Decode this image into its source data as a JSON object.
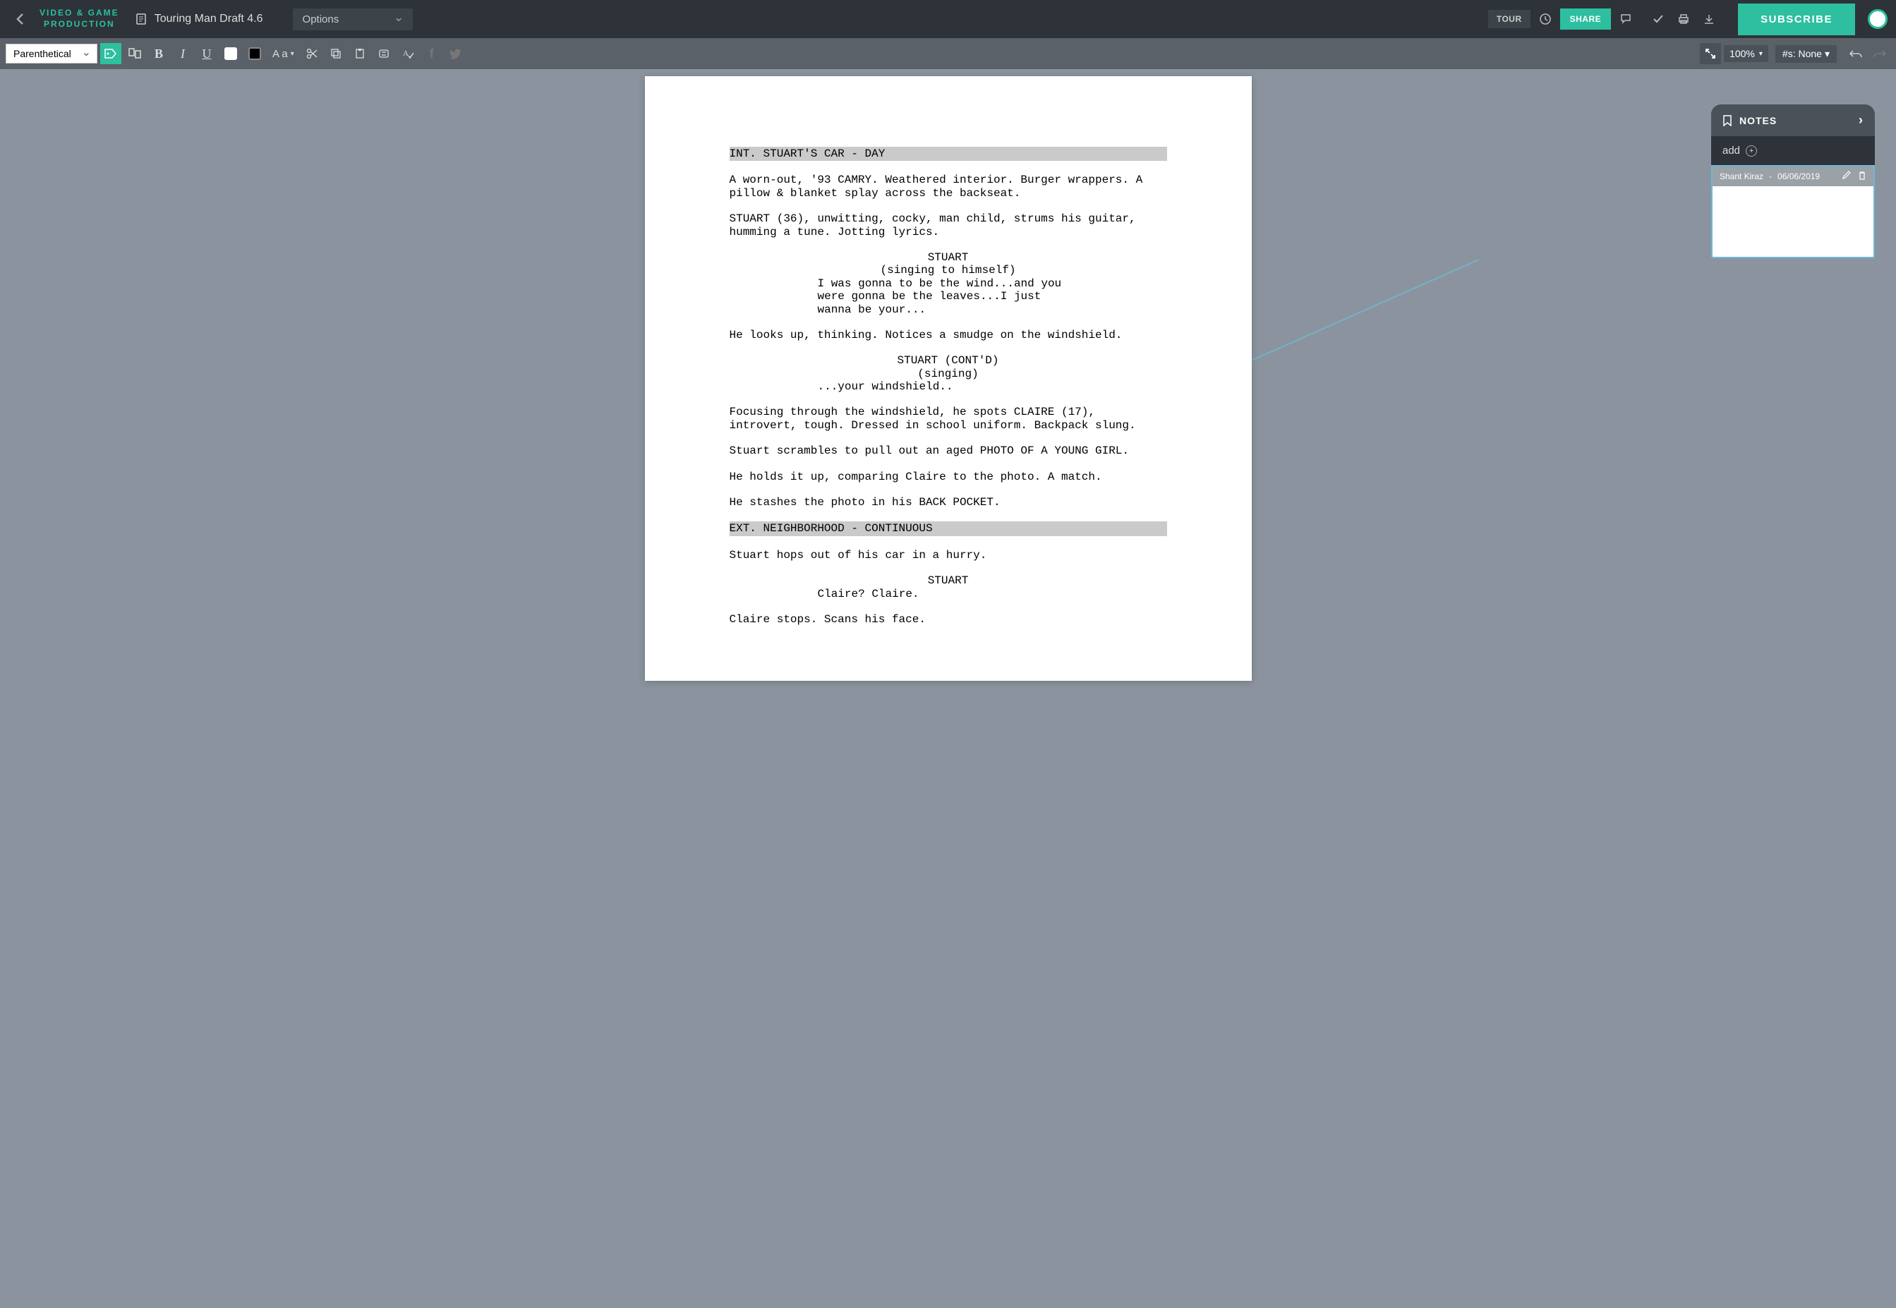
{
  "brand": {
    "line1": "VIDEO & GAME",
    "line2": "PRODUCTION"
  },
  "doc_title": "Touring Man Draft 4.6",
  "options_label": "Options",
  "topbar": {
    "tour": "TOUR",
    "share": "SHARE",
    "subscribe": "SUBSCRIBE"
  },
  "toolbar": {
    "element_type": "Parenthetical",
    "bold": "B",
    "italic": "I",
    "underline": "U",
    "case": "A a",
    "zoom": "100%",
    "scene_num": "#s: None"
  },
  "notes": {
    "title": "NOTES",
    "add_label": "add",
    "card": {
      "author": "Shant Kiraz",
      "date": "06/06/2019"
    }
  },
  "script": {
    "scene1_heading": "INT. STUART'S CAR - DAY",
    "action1": "A worn-out, '93 CAMRY. Weathered interior. Burger wrappers. A pillow & blanket splay across the backseat.",
    "action2": "STUART (36), unwitting, cocky, man child, strums his guitar, humming a tune. Jotting lyrics.",
    "char1": "STUART",
    "paren1": "(singing to himself)",
    "dial1": "I was gonna to be the wind...and you were gonna be the leaves...I just wanna be your...",
    "action3": "He looks up, thinking. Notices a smudge on the windshield.",
    "char2": "STUART (CONT'D)",
    "paren2": "(singing)",
    "dial2": "...your windshield..",
    "action4": "Focusing through the windshield, he spots CLAIRE (17), introvert, tough. Dressed in school uniform. Backpack slung.",
    "action5": "Stuart scrambles to pull out an aged PHOTO OF A YOUNG GIRL.",
    "action6": "He holds it up, comparing Claire to the photo. A match.",
    "action7": "He stashes the photo in his BACK POCKET.",
    "scene2_heading": "EXT. NEIGHBORHOOD - CONTINUOUS",
    "action8": "Stuart hops out of his car in a hurry.",
    "char3": "STUART",
    "dial3": "Claire? Claire.",
    "action9": "Claire stops. Scans his face."
  }
}
